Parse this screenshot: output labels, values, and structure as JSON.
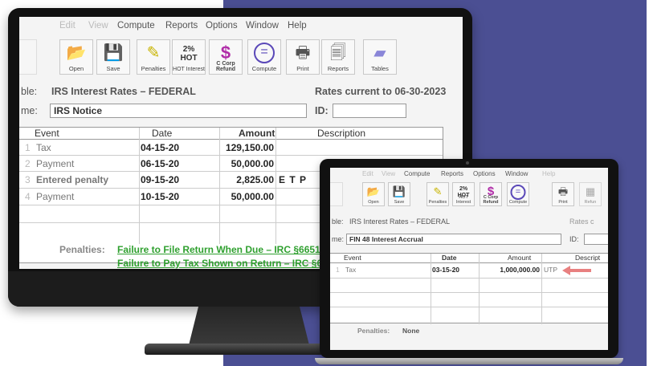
{
  "colors": {
    "background_panel": "#4b4f93",
    "link_green": "#2fa02f",
    "arrow": "#e88080"
  },
  "desktop": {
    "menu": [
      "Edit",
      "View",
      "Compute",
      "Reports",
      "Options",
      "Window",
      "Help"
    ],
    "toolbar": [
      {
        "label": "Open",
        "icon": "folder-open-icon"
      },
      {
        "label": "Save",
        "icon": "floppy-disk-icon"
      },
      {
        "label": "Penalties",
        "icon": "penalty-scale-icon"
      },
      {
        "label": "HOT Interest",
        "icon": "percent-icon"
      },
      {
        "label": "C Corp Refund",
        "icon": "dollar-icon"
      },
      {
        "label": "Compute",
        "icon": "equals-icon"
      },
      {
        "label": "Print",
        "icon": "printer-icon"
      },
      {
        "label": "Reports",
        "icon": "reports-icon"
      },
      {
        "label": "Tables",
        "icon": "usa-map-icon"
      }
    ],
    "toolbar_bigtext": {
      "hot": "2%",
      "hot_sub": "HOT",
      "corp": "C Corp"
    },
    "table_label": "ble:",
    "table_value": "IRS Interest Rates – FEDERAL",
    "rates_current": "Rates current to 06-30-2023",
    "name_label": "me:",
    "name_value": "IRS Notice",
    "id_label": "ID:",
    "id_value": "",
    "columns": [
      "Event",
      "Date",
      "Amount",
      "Description"
    ],
    "rows": [
      {
        "num": "1",
        "event": "Tax",
        "date": "04-15-20",
        "amount": "129,150.00",
        "desc": ""
      },
      {
        "num": "2",
        "event": "Payment",
        "date": "06-15-20",
        "amount": "50,000.00",
        "desc": ""
      },
      {
        "num": "3",
        "event": "Entered penalty",
        "date": "09-15-20",
        "amount": "2,825.00",
        "desc": "E T P"
      },
      {
        "num": "4",
        "event": "Payment",
        "date": "10-15-20",
        "amount": "50,000.00",
        "desc": ""
      }
    ],
    "penalties_label": "Penalties:",
    "penalty_links": [
      "Failure to File Return When Due – IRC §6651",
      "Failure to Pay Tax Shown on Return – IRC §6"
    ]
  },
  "laptop": {
    "menu": [
      "Edit",
      "View",
      "Compute",
      "Reports",
      "Options",
      "Window",
      "Help"
    ],
    "toolbar": [
      {
        "label": "Open",
        "icon": "folder-open-icon"
      },
      {
        "label": "Save",
        "icon": "floppy-disk-icon"
      },
      {
        "label": "Penalties",
        "icon": "penalty-scale-icon"
      },
      {
        "label": "HOT Interest",
        "icon": "percent-icon"
      },
      {
        "label": "C Corp Refund",
        "icon": "dollar-icon"
      },
      {
        "label": "Compute",
        "icon": "equals-icon"
      },
      {
        "label": "Print",
        "icon": "printer-icon"
      },
      {
        "label": "Refun",
        "icon": "refund-icon"
      }
    ],
    "table_label": "ble:",
    "table_value": "IRS Interest Rates – FEDERAL",
    "rates_current": "Rates c",
    "name_label": "me:",
    "name_value": "FIN 48 Interest Accrual",
    "id_label": "ID:",
    "columns": [
      "Event",
      "Date",
      "Amount",
      "Descript"
    ],
    "rows": [
      {
        "num": "1",
        "event": "Tax",
        "date": "03-15-20",
        "amount": "1,000,000.00",
        "desc": "UTP"
      }
    ],
    "penalties_label": "Penalties:",
    "penalties_value": "None"
  }
}
